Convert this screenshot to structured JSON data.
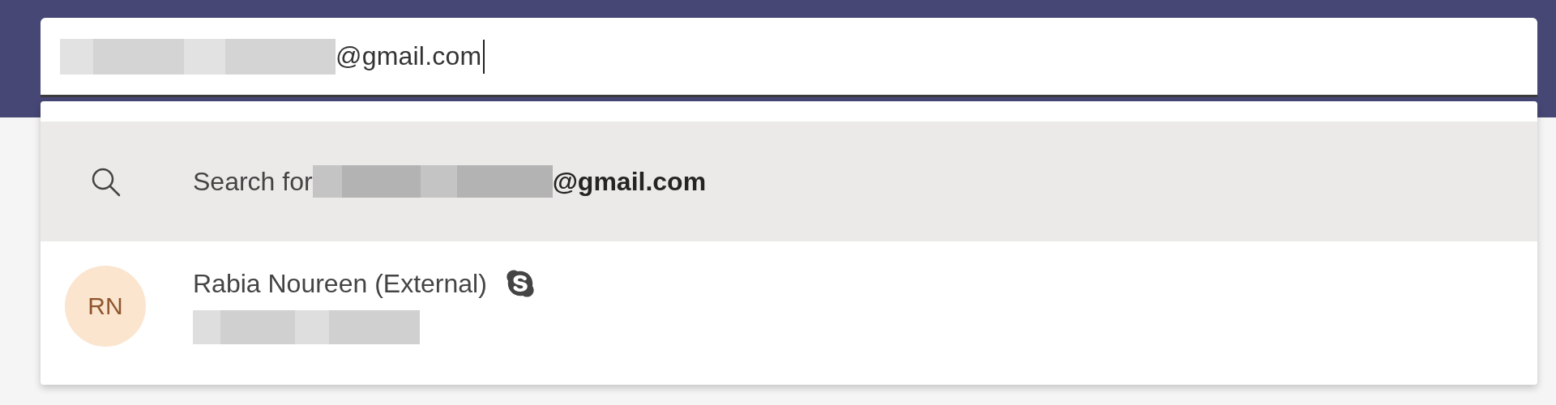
{
  "search_field": {
    "value": "@gmail.com",
    "focused": true
  },
  "suggestions": [
    {
      "kind": "search",
      "label": "Search for",
      "query": "@gmail.com",
      "selected": true
    },
    {
      "kind": "person",
      "initials": "RN",
      "name": "Rabia Noureen (External)",
      "color": "#fbe5cf",
      "selected": false
    }
  ]
}
